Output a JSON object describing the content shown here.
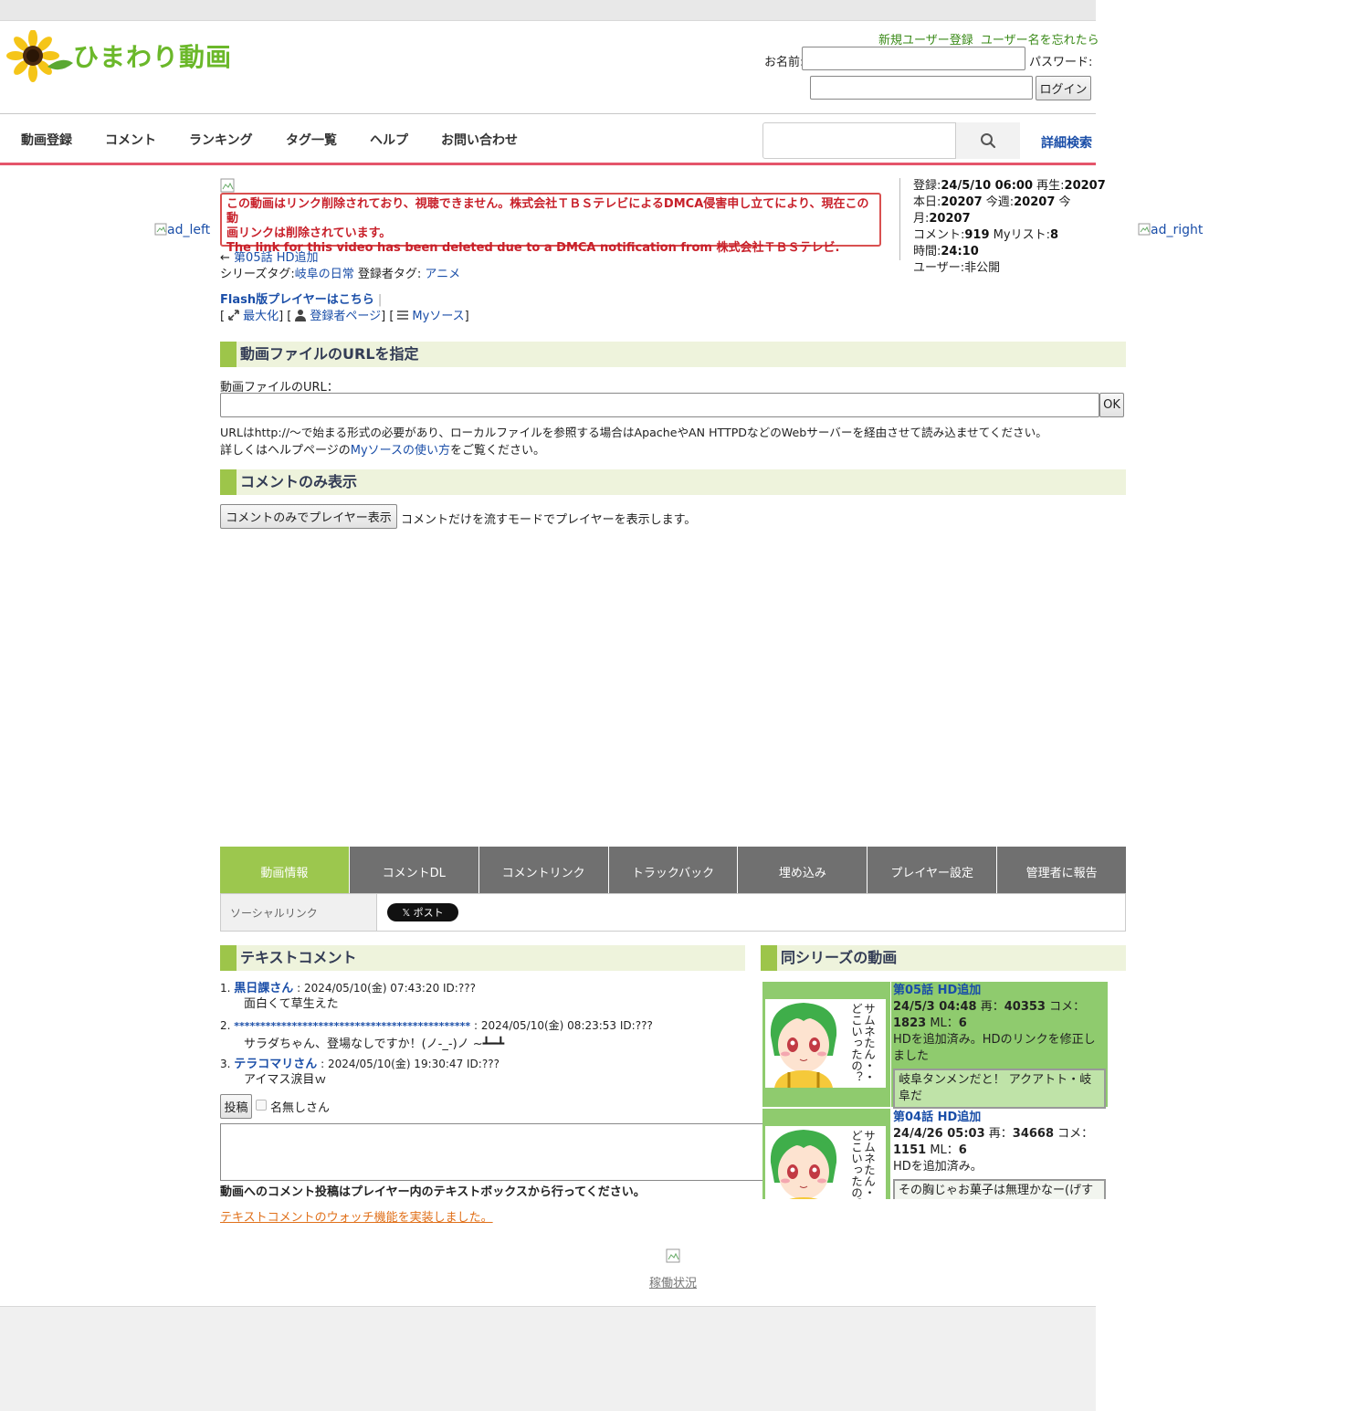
{
  "header": {
    "logo_text": "ひまわり動画",
    "register_link": "新規ユーザー登録",
    "forgot_link": "ユーザー名を忘れたら",
    "name_label": "お名前:",
    "password_label": "パスワード:",
    "login_button": "ログイン"
  },
  "nav": {
    "items": [
      "動画登録",
      "コメント",
      "ランキング",
      "タグ一覧",
      "ヘルプ",
      "お問い合わせ"
    ],
    "advanced_search": "詳細検索"
  },
  "ads": {
    "left": "ad_left",
    "right": "ad_right"
  },
  "video": {
    "dmca_line1": "この動画はリンク削除されており、視聴できません。株式会社ＴＢＳテレビによるDMCA侵害申し立てにより、現在この動",
    "dmca_line2": "画リンクは削除されています。",
    "dmca_line3": "The link for this video has been deleted due to a DMCA notification from 株式会社ＴＢＳテレビ.",
    "prev_arrow": "←",
    "prev_link": "第05話 HD追加",
    "series_tag_label": "シリーズタグ:",
    "series_tag": "岐阜の日常",
    "user_tag_label": " 登録者タグ: ",
    "user_tag": "アニメ",
    "flash_link": "Flash版プレイヤーはこちら",
    "maximize": "最大化",
    "uploader_page": "登録者ページ",
    "mysource": "Myソース"
  },
  "stats": {
    "registered_label": "登録:",
    "registered": "24/5/10 06:00",
    "plays_label": " 再生:",
    "plays": "20207",
    "today_label": "本日:",
    "today": "20207",
    "week_label": " 今週:",
    "week": "20207",
    "month_label": " 今月:",
    "month": "20207",
    "comments_label": "コメント:",
    "comments": "919",
    "mylist_label": " Myリスト:",
    "mylist": "8",
    "duration_label": "時間:",
    "duration": "24:10",
    "user_label": "ユーザー:非公開"
  },
  "url_section": {
    "heading": "動画ファイルのURLを指定",
    "field_label": "動画ファイルのURL：",
    "ok": "OK",
    "note1": "URLはhttp://～で始まる形式の必要があり、ローカルファイルを参照する場合はApacheやAN HTTPDなどのWebサーバーを経由させて読み込ませてください。",
    "note2_pre": "詳しくはヘルプページの",
    "note2_link": "Myソースの使い方",
    "note2_post": "をご覧ください。"
  },
  "comment_only": {
    "heading": "コメントのみ表示",
    "button": "コメントのみでプレイヤー表示",
    "desc": "コメントだけを流すモードでプレイヤーを表示します。"
  },
  "tabs": [
    "動画情報",
    "コメントDL",
    "コメントリンク",
    "トラックバック",
    "埋め込み",
    "プレイヤー設定",
    "管理者に報告"
  ],
  "social": {
    "label": "ソーシャルリンク",
    "post": "𝕏 ポスト"
  },
  "text_comments": {
    "heading": "テキストコメント",
    "items": [
      {
        "num": "1.",
        "name": "黒日課さん",
        "meta": " : 2024/05/10(金) 07:43:20 ID:???",
        "text": "面白くて草生えた"
      },
      {
        "num": "2.",
        "name": "*********************************************",
        "meta": " : 2024/05/10(金) 08:23:53 ID:???",
        "text": "サラダちゃん、登場なしですか！(ノ-_-)ノ ~┻━┻"
      },
      {
        "num": "3.",
        "name": "テラコマリさん",
        "meta": " : 2024/05/10(金) 19:30:47 ID:???",
        "text": "アイマス涙目ｗ"
      }
    ],
    "post_button": "投稿",
    "anon_label": "名無しさん",
    "notice": "動画へのコメント投稿はプレイヤー内のテキストボックスから行ってください。",
    "watch_link": "テキストコメントのウォッチ機能を実装しました。"
  },
  "series": {
    "heading": "同シリーズの動画",
    "items": [
      {
        "title": "第05話 HD追加",
        "date": "24/5/3 04:48",
        "plays_label": " 再：",
        "plays": "40353",
        "comments_label": " コメ：",
        "comments": "1823",
        "ml_label": " ML：",
        "ml": "6",
        "desc": "HDを追加済み。HDのリンクを修正しました",
        "tag": "岐阜タンメンだと！ アクアトト・岐阜だ",
        "thumb_text": "サムネたん・・どこいったの？"
      },
      {
        "title": "第04話 HD追加",
        "date": "24/4/26 05:03",
        "plays_label": " 再：",
        "plays": "34668",
        "comments_label": " コメ：",
        "comments": "1151",
        "ml_label": " ML：",
        "ml": "6",
        "desc": "HDを追加済み。",
        "tag": "その胸じゃお菓子は無理かなー(げす顔",
        "thumb_text": "サムネたん・・どこいったの？"
      }
    ]
  },
  "footer": {
    "status_link": "稼働状況"
  },
  "colors": {
    "accent_red": "#e5556b",
    "green": "#9cc74e",
    "link": "#1a4ea8"
  }
}
